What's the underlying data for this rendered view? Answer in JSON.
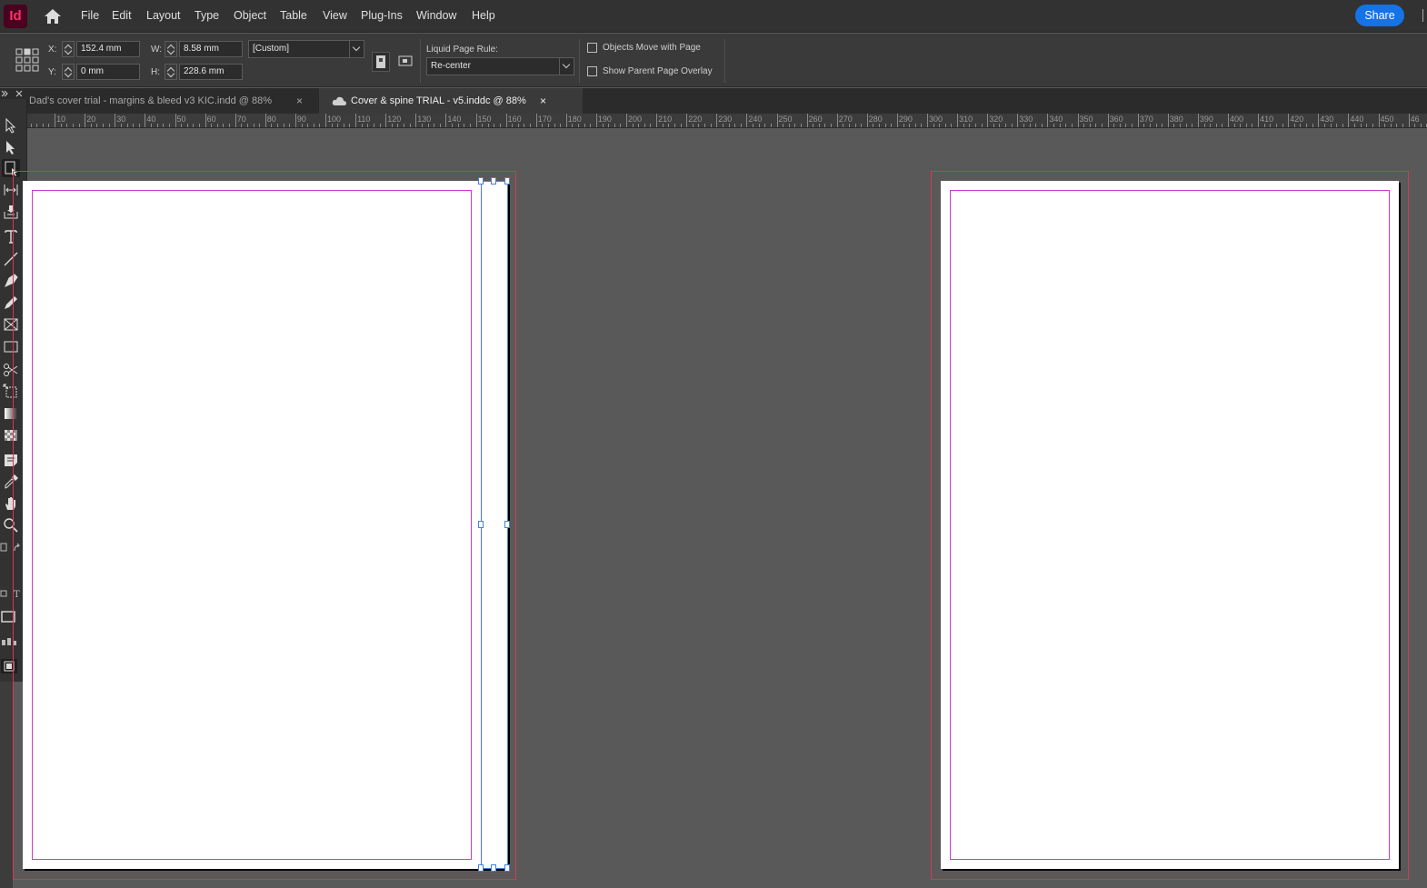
{
  "app": {
    "logo_text": "Id",
    "accent_color": "#ff3366",
    "logo_bg": "#49021f"
  },
  "menu": {
    "items": [
      "File",
      "Edit",
      "Layout",
      "Type",
      "Object",
      "Table",
      "View",
      "Plug-Ins",
      "Window",
      "Help"
    ],
    "share_label": "Share"
  },
  "control": {
    "x_label": "X:",
    "x_value": "152.4 mm",
    "y_label": "Y:",
    "y_value": "0 mm",
    "w_label": "W:",
    "w_value": "8.58 mm",
    "h_label": "H:",
    "h_value": "228.6 mm",
    "preset_value": "[Custom]",
    "liquid_label": "Liquid Page Rule:",
    "liquid_value": "Re-center",
    "objects_move_label": "Objects Move with Page",
    "show_parent_label": "Show Parent Page Overlay"
  },
  "tabs": [
    {
      "label": "Dad's cover trial - margins & bleed v3 KIC.indd @ 88%",
      "close": "×",
      "active": false
    },
    {
      "label": "Cover & spine TRIAL - v5.inddc @ 88%",
      "close": "×",
      "active": true
    }
  ],
  "ruler": {
    "labels": [
      "10",
      "20",
      "30",
      "40",
      "50",
      "60",
      "70",
      "80",
      "90",
      "100",
      "110",
      "120",
      "130",
      "140",
      "150",
      "160",
      "170",
      "180",
      "190",
      "200",
      "210",
      "220",
      "230",
      "240",
      "250",
      "260",
      "270",
      "280",
      "290",
      "300",
      "310",
      "320",
      "330",
      "340",
      "350",
      "360",
      "370",
      "380",
      "390",
      "400",
      "410",
      "420",
      "430",
      "440",
      "450",
      "46"
    ]
  },
  "toolbar": {
    "tools": [
      "selection-tool",
      "direct-selection-tool",
      "page-tool",
      "gap-tool",
      "content-collector-tool",
      "type-tool",
      "line-tool",
      "pen-tool",
      "pencil-tool",
      "rectangle-frame-tool",
      "rectangle-tool",
      "scissors-tool",
      "free-transform-tool",
      "gradient-swatch-tool",
      "gradient-feather-tool",
      "note-tool",
      "eyedropper-tool",
      "hand-tool",
      "zoom-tool"
    ],
    "format_text_glyph": "T"
  },
  "colors": {
    "bleed": "#d13b55",
    "margin": "#c93ad1",
    "frame_select": "#4a7fd6",
    "pasteboard": "#595959"
  }
}
